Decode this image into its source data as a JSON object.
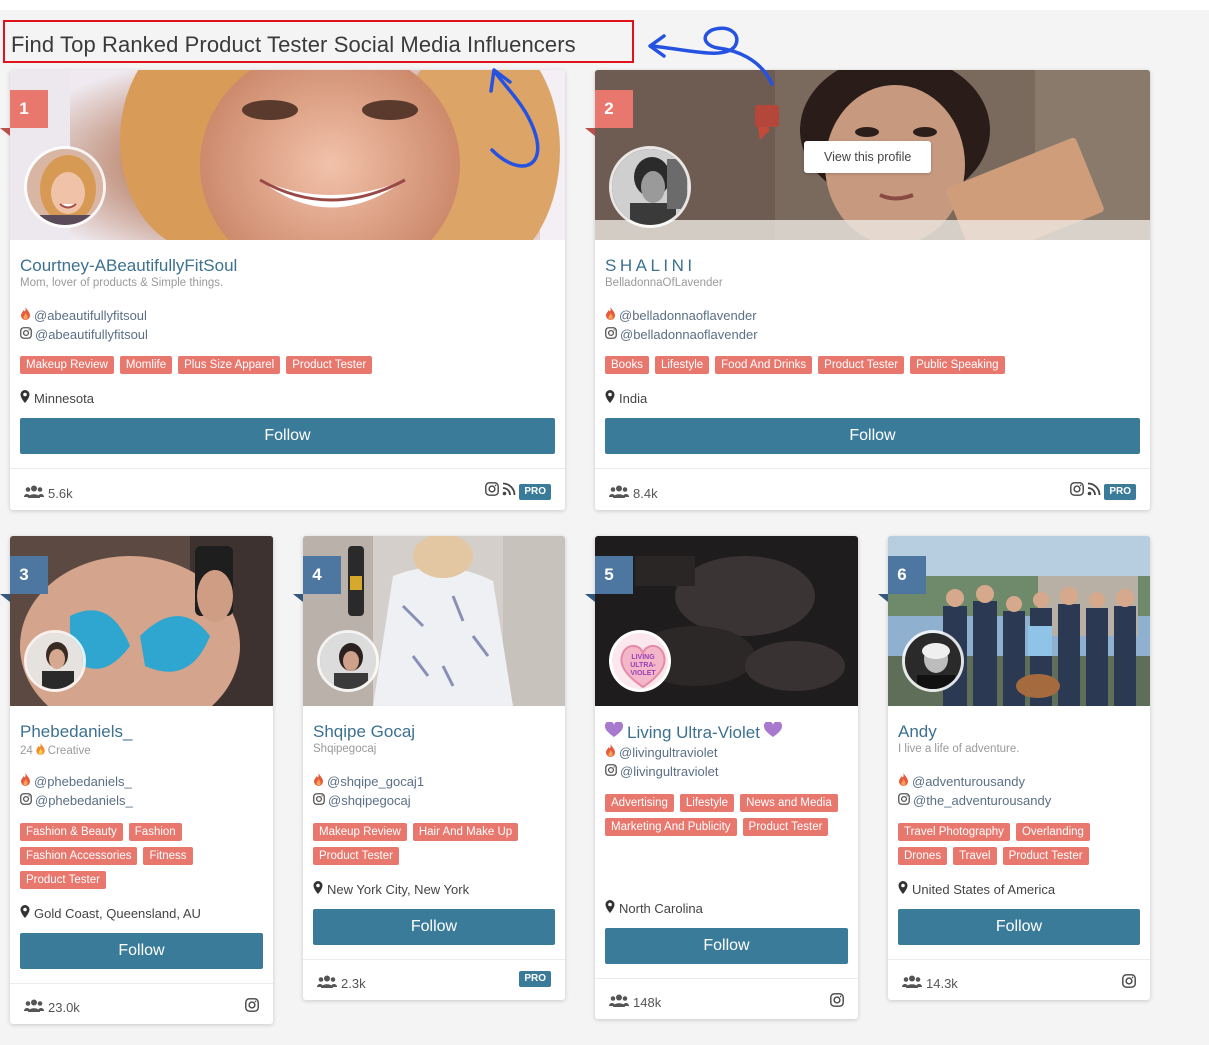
{
  "page_title": "Find Top Ranked Product Tester Social Media Influencers",
  "hover_label": "View this profile",
  "colors": {
    "accent": "#3b7b9a",
    "tag": "#e8776e",
    "rank_red": "#e8776e",
    "rank_blue": "#4d77a1",
    "annotation_box": "#e0131b",
    "annotation_arrow": "#2552e0"
  },
  "influencers": [
    {
      "rank": "1",
      "name": "Courtney-ABeautifullyFitSoul",
      "subtitle": "Mom, lover of products & Simple things.",
      "handle_primary": "@abeautifullyfitsoul",
      "handle_instagram": "@abeautifullyfitsoul",
      "tags": [
        "Makeup Review",
        "Momlife",
        "Plus Size Apparel",
        "Product Tester"
      ],
      "location": "Minnesota",
      "follow_label": "Follow",
      "followers": "5.6k",
      "pro": "PRO"
    },
    {
      "rank": "2",
      "name": "SHALINI",
      "subtitle": "BelladonnaOfLavender",
      "handle_primary": "@belladonnaoflavender",
      "handle_instagram": "@belladonnaoflavender",
      "tags": [
        "Books",
        "Lifestyle",
        "Food And Drinks",
        "Product Tester",
        "Public Speaking"
      ],
      "location": "India",
      "follow_label": "Follow",
      "followers": "8.4k",
      "pro": "PRO"
    },
    {
      "rank": "3",
      "name": "Phebedaniels_",
      "subtitle_number": "24",
      "subtitle_text": "Creative",
      "handle_primary": "@phebedaniels_",
      "handle_instagram": "@phebedaniels_",
      "tags": [
        "Fashion & Beauty",
        "Fashion",
        "Fashion Accessories",
        "Fitness",
        "Product Tester"
      ],
      "location": "Gold Coast, Queensland, AU",
      "follow_label": "Follow",
      "followers": "23.0k"
    },
    {
      "rank": "4",
      "name": "Shqipe Gocaj",
      "subtitle": "Shqipegocaj",
      "handle_primary": "@shqipe_gocaj1",
      "handle_instagram": "@shqipegocaj",
      "tags": [
        "Makeup Review",
        "Hair And Make Up",
        "Product Tester"
      ],
      "location": "New York City, New York",
      "follow_label": "Follow",
      "followers": "2.3k",
      "pro": "PRO"
    },
    {
      "rank": "5",
      "name": "Living Ultra-Violet",
      "avatar_text": "LIVING ULTRA-VIOLET",
      "handle_primary": "@livingultraviolet",
      "handle_instagram": "@livingultraviolet",
      "tags": [
        "Advertising",
        "Lifestyle",
        "News and Media",
        "Marketing And Publicity",
        "Product Tester"
      ],
      "location": "North Carolina",
      "follow_label": "Follow",
      "followers": "148k"
    },
    {
      "rank": "6",
      "name": "Andy",
      "subtitle": "I live a life of adventure.",
      "handle_primary": "@adventurousandy",
      "handle_instagram": "@the_adventurousandy",
      "tags": [
        "Travel Photography",
        "Overlanding",
        "Drones",
        "Travel",
        "Product Tester"
      ],
      "location": "United States of America",
      "follow_label": "Follow",
      "followers": "14.3k"
    }
  ]
}
